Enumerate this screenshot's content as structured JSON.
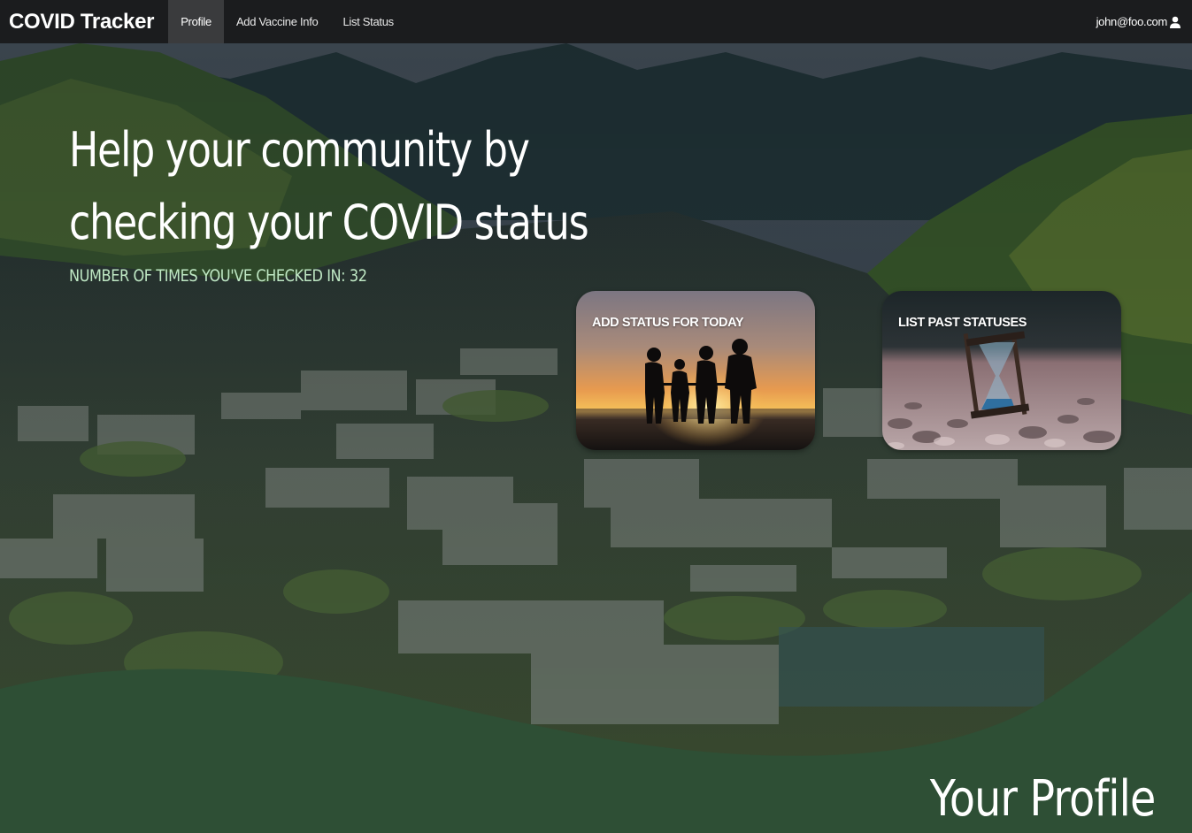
{
  "navbar": {
    "brand": "COVID Tracker",
    "items": [
      {
        "label": "Profile",
        "active": true
      },
      {
        "label": "Add Vaccine Info",
        "active": false
      },
      {
        "label": "List Status",
        "active": false
      }
    ],
    "user_email": "john@foo.com",
    "user_icon": "user-icon"
  },
  "hero": {
    "headline_line1": "Help your community by",
    "headline_line2": "checking your COVID status",
    "checkin_text": "NUMBER OF TIMES YOU'VE CHECKED IN: 32",
    "cards": [
      {
        "label": "ADD STATUS FOR TODAY",
        "image": "family-sunset-silhouette"
      },
      {
        "label": "LIST PAST STATUSES",
        "image": "hourglass-on-pebbles"
      }
    ]
  },
  "section": {
    "title": "Your Profile"
  },
  "colors": {
    "navbar_bg": "#1b1c1e",
    "accent_green": "#2e4f35",
    "checkin_text": "#bfe8c4"
  }
}
